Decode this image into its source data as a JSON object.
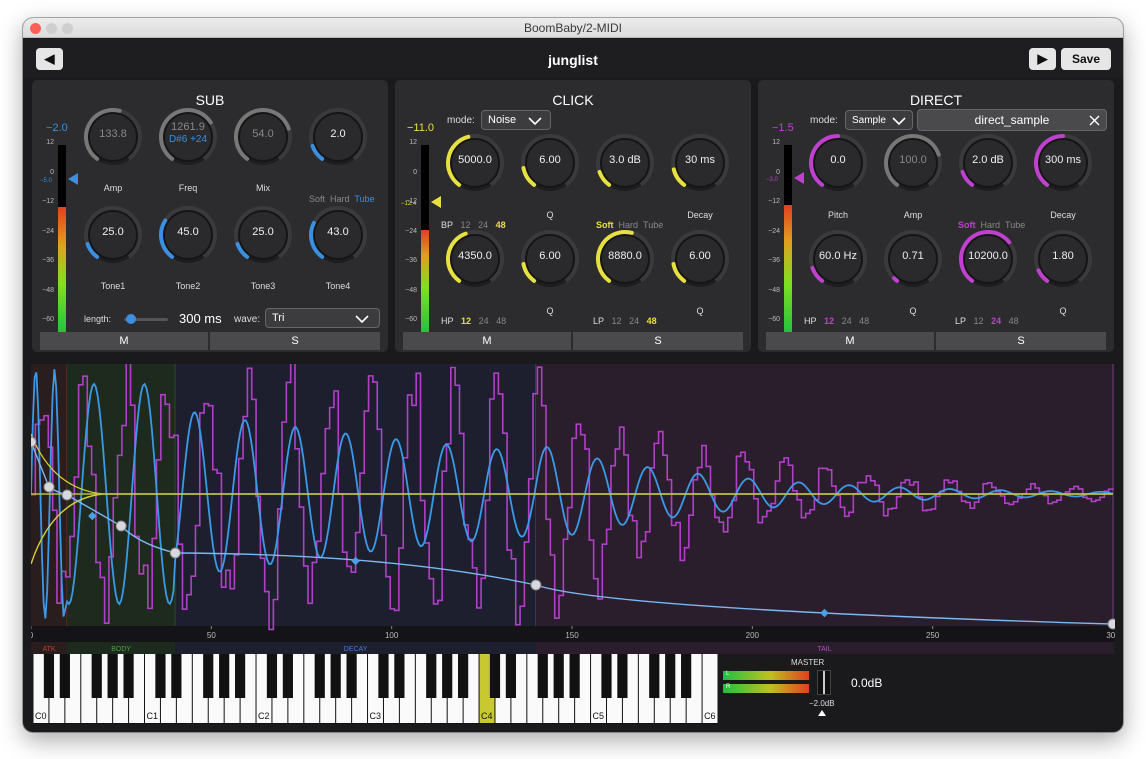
{
  "window": {
    "title": "BoomBaby/2-MIDI"
  },
  "topbar": {
    "preset_name": "junglist",
    "prev_icon": "◀",
    "play_icon": "▶",
    "save_label": "Save"
  },
  "sub": {
    "title": "SUB",
    "level": "−2.0",
    "meter_marker": "−5.0",
    "knobs": [
      {
        "id": "amp",
        "value": "133.8",
        "label": "Amp"
      },
      {
        "id": "freq",
        "value": "1261.9",
        "sub": "D#6 +24",
        "label": "Freq"
      },
      {
        "id": "mix",
        "value": "54.0",
        "label": "Mix"
      },
      {
        "id": "drive",
        "value": "2.0",
        "label": ""
      },
      {
        "id": "tone1",
        "value": "25.0",
        "label": "Tone1"
      },
      {
        "id": "tone2",
        "value": "45.0",
        "label": "Tone2"
      },
      {
        "id": "tone3",
        "value": "25.0",
        "label": "Tone3"
      },
      {
        "id": "tone4",
        "value": "43.0",
        "label": "Tone4"
      }
    ],
    "sat": {
      "soft": "Soft",
      "hard": "Hard",
      "tube": "Tube"
    },
    "length_label": "length:",
    "length_value": "300 ms",
    "wave_label": "wave:",
    "wave_value": "Tri",
    "mute": "M",
    "solo": "S"
  },
  "click": {
    "title": "CLICK",
    "level": "−11.0",
    "meter_marker": "−12.4",
    "mode_label": "mode:",
    "mode_value": "Noise",
    "knobs": [
      {
        "id": "bp",
        "value": "5000.0",
        "label": ""
      },
      {
        "id": "bpq",
        "value": "6.00",
        "label": "Q"
      },
      {
        "id": "drive",
        "value": "3.0 dB",
        "label": ""
      },
      {
        "id": "decay",
        "value": "30 ms",
        "label": "Decay"
      },
      {
        "id": "hp",
        "value": "4350.0",
        "label": ""
      },
      {
        "id": "hpq",
        "value": "6.00",
        "label": "Q"
      },
      {
        "id": "lp",
        "value": "8880.0",
        "label": ""
      },
      {
        "id": "lpq",
        "value": "6.00",
        "label": "Q"
      }
    ],
    "bp": {
      "label": "BP",
      "s12": "12",
      "s24": "24",
      "s48": "48"
    },
    "hp": {
      "label": "HP",
      "s12": "12",
      "s24": "24",
      "s48": "48"
    },
    "lp": {
      "label": "LP",
      "s12": "12",
      "s24": "24",
      "s48": "48"
    },
    "sat": {
      "soft": "Soft",
      "hard": "Hard",
      "tube": "Tube"
    },
    "mute": "M",
    "solo": "S"
  },
  "direct": {
    "title": "DIRECT",
    "level": "−1.5",
    "meter_marker": "−3.0",
    "mode_label": "mode:",
    "mode_value": "Sample",
    "sample_name": "direct_sample",
    "knobs": [
      {
        "id": "pitch",
        "value": "0.0",
        "label": "Pitch"
      },
      {
        "id": "amp",
        "value": "100.0",
        "label": "Amp"
      },
      {
        "id": "drive",
        "value": "2.0 dB",
        "label": ""
      },
      {
        "id": "decay",
        "value": "300 ms",
        "label": "Decay"
      },
      {
        "id": "hp",
        "value": "60.0 Hz",
        "label": ""
      },
      {
        "id": "hpq",
        "value": "0.71",
        "label": "Q"
      },
      {
        "id": "lp",
        "value": "10200.0",
        "label": ""
      },
      {
        "id": "lpq",
        "value": "1.80",
        "label": "Q"
      }
    ],
    "hp": {
      "label": "HP",
      "s12": "12",
      "s24": "24",
      "s48": "48"
    },
    "lp": {
      "label": "LP",
      "s12": "12",
      "s24": "24",
      "s48": "48"
    },
    "sat": {
      "soft": "Soft",
      "hard": "Hard",
      "tube": "Tube"
    },
    "mute": "M",
    "solo": "S"
  },
  "meter_scale": [
    "12",
    "0",
    "−12",
    "−24",
    "−36",
    "−48",
    "−60"
  ],
  "envelope": {
    "x_ticks": [
      "0",
      "50",
      "100",
      "150",
      "200",
      "250",
      "300"
    ],
    "sections": [
      "ATK",
      "BODY",
      "DECAY",
      "TAIL"
    ]
  },
  "keyboard": {
    "octaves": [
      "C0",
      "C1",
      "C2",
      "C3",
      "C4",
      "C5",
      "C6"
    ]
  },
  "master": {
    "label": "MASTER",
    "gain": "0.0dB",
    "trim": "−2.0dB",
    "l": "L",
    "r": "R"
  },
  "colors": {
    "sub": "#3a8fe0",
    "click": "#e8e040",
    "direct": "#c040d0"
  }
}
